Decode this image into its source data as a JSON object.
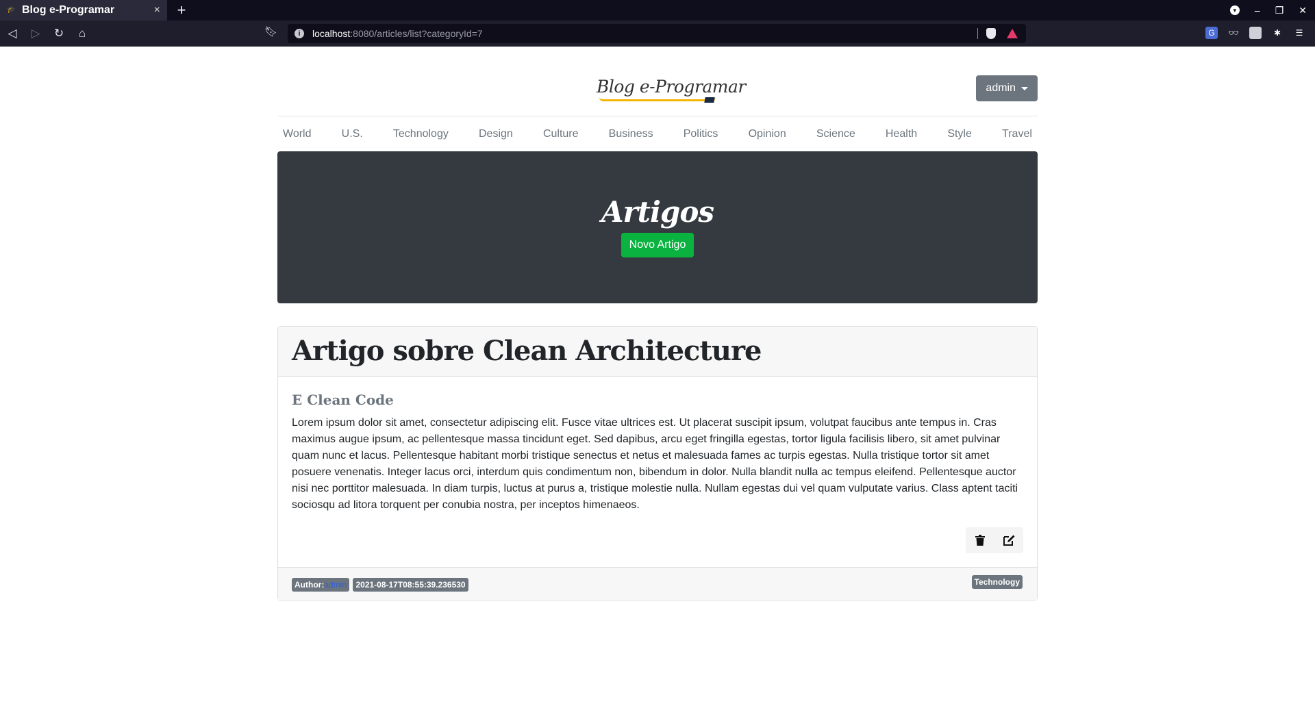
{
  "browser": {
    "tab_title": "Blog e-Programar",
    "tab_close": "×",
    "new_tab": "+",
    "url_host": "localhost",
    "url_rest": ":8080/articles/list?categoryId=7"
  },
  "site": {
    "logo_text": "Blog e-Programar",
    "user_button": "admin",
    "nav": [
      "World",
      "U.S.",
      "Technology",
      "Design",
      "Culture",
      "Business",
      "Politics",
      "Opinion",
      "Science",
      "Health",
      "Style",
      "Travel"
    ]
  },
  "hero": {
    "title": "Artigos",
    "new_button": "Novo Artigo"
  },
  "article": {
    "title": "Artigo sobre Clean Architecture",
    "subtitle": "E Clean Code",
    "body": "Lorem ipsum dolor sit amet, consectetur adipiscing elit. Fusce vitae ultrices est. Ut placerat suscipit ipsum, volutpat faucibus ante tempus in. Cras maximus augue ipsum, ac pellentesque massa tincidunt eget. Sed dapibus, arcu eget fringilla egestas, tortor ligula facilisis libero, sit amet pulvinar quam nunc et lacus. Pellentesque habitant morbi tristique senectus et netus et malesuada fames ac turpis egestas. Nulla tristique tortor sit amet posuere venenatis. Integer lacus orci, interdum quis condimentum non, bibendum in dolor. Nulla blandit nulla ac tempus eleifend. Pellentesque auctor nisi nec porttitor malesuada. In diam turpis, luctus at purus a, tristique molestie nulla. Nullam egestas dui vel quam vulputate varius. Class aptent taciti sociosqu ad litora torquent per conubia nostra, per inceptos himenaeos.",
    "author_label": "Author:",
    "author_name": "admin",
    "timestamp": "2021-08-17T08:55:39.236530",
    "category": "Technology"
  },
  "icons": {
    "back": "back-arrow-icon",
    "forward": "forward-arrow-icon",
    "reload": "reload-icon",
    "home": "home-icon",
    "delete": "trash-icon",
    "edit": "edit-icon"
  },
  "colors": {
    "hero_bg": "#343a40",
    "primary_green": "#0ab23f",
    "secondary_gray": "#6c757d"
  }
}
